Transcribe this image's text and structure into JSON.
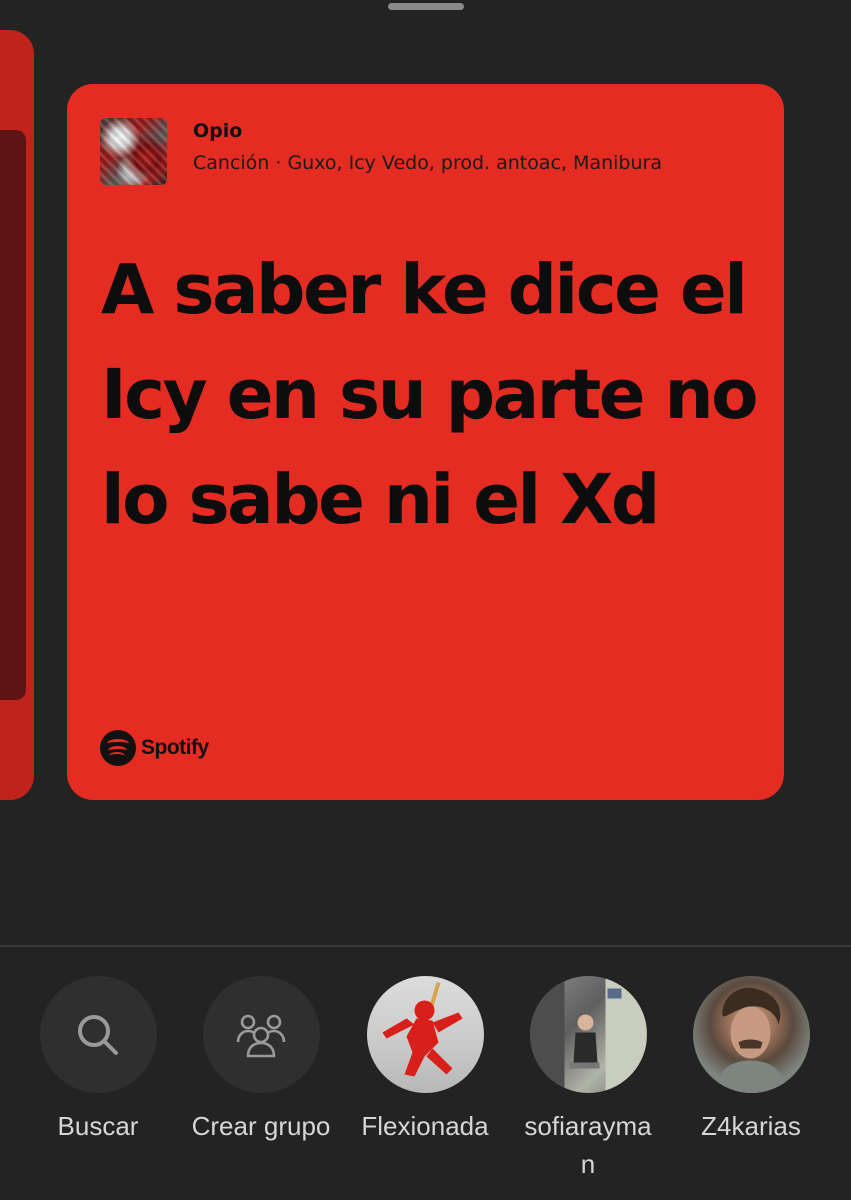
{
  "card": {
    "track_title": "Opio",
    "track_meta": "Canción · Guxo, Icy Vedo, prod. antoac, Manibura",
    "lyrics": "A saber ke dice el Icy en su parte no lo sabe ni el Xd",
    "brand": "Spotify",
    "background_color": "#e42c22"
  },
  "share": {
    "items": [
      {
        "label": "Buscar",
        "icon": "search-icon"
      },
      {
        "label": "Crear grupo",
        "icon": "group-icon"
      },
      {
        "label": "Flexionada",
        "icon": "avatar"
      },
      {
        "label": "sofiarayman",
        "icon": "avatar"
      },
      {
        "label": "Z4karias",
        "icon": "avatar"
      }
    ]
  }
}
